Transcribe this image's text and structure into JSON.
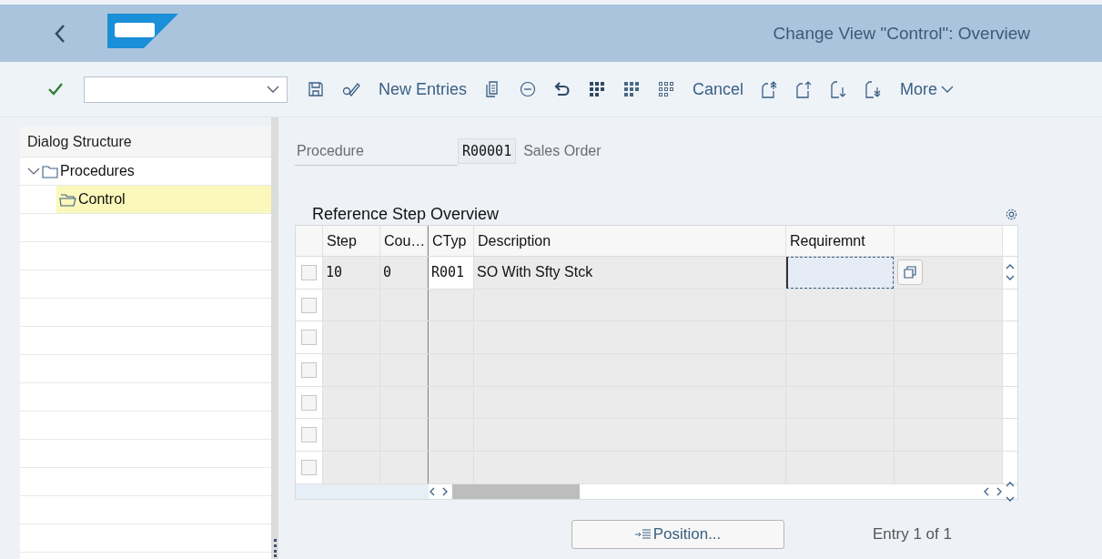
{
  "header": {
    "title": "Change View \"Control\": Overview"
  },
  "toolbar": {
    "new_entries": "New Entries",
    "cancel": "Cancel",
    "more": "More"
  },
  "dialog_structure": {
    "title": "Dialog Structure",
    "tree": [
      {
        "label": "Procedures",
        "expanded": true,
        "selected": false,
        "children": [
          {
            "label": "Control",
            "selected": true
          }
        ]
      }
    ]
  },
  "procedure": {
    "label": "Procedure",
    "value": "R00001",
    "description": "Sales Order"
  },
  "table": {
    "title": "Reference Step Overview",
    "columns": [
      "Step",
      "Cou…",
      "CTyp",
      "Description",
      "Requiremnt"
    ],
    "rows": [
      {
        "selected": false,
        "editing": true,
        "cells": [
          "10",
          "0",
          "R001",
          "SO With Sfty Stck"
        ]
      },
      {
        "selected": false,
        "editing": false
      },
      {
        "selected": false,
        "editing": false
      },
      {
        "selected": false,
        "editing": false
      },
      {
        "selected": false,
        "editing": false
      },
      {
        "selected": false,
        "editing": false
      },
      {
        "selected": false,
        "editing": false
      }
    ]
  },
  "position_button": "Position...",
  "entry_info": "Entry 1 of 1"
}
